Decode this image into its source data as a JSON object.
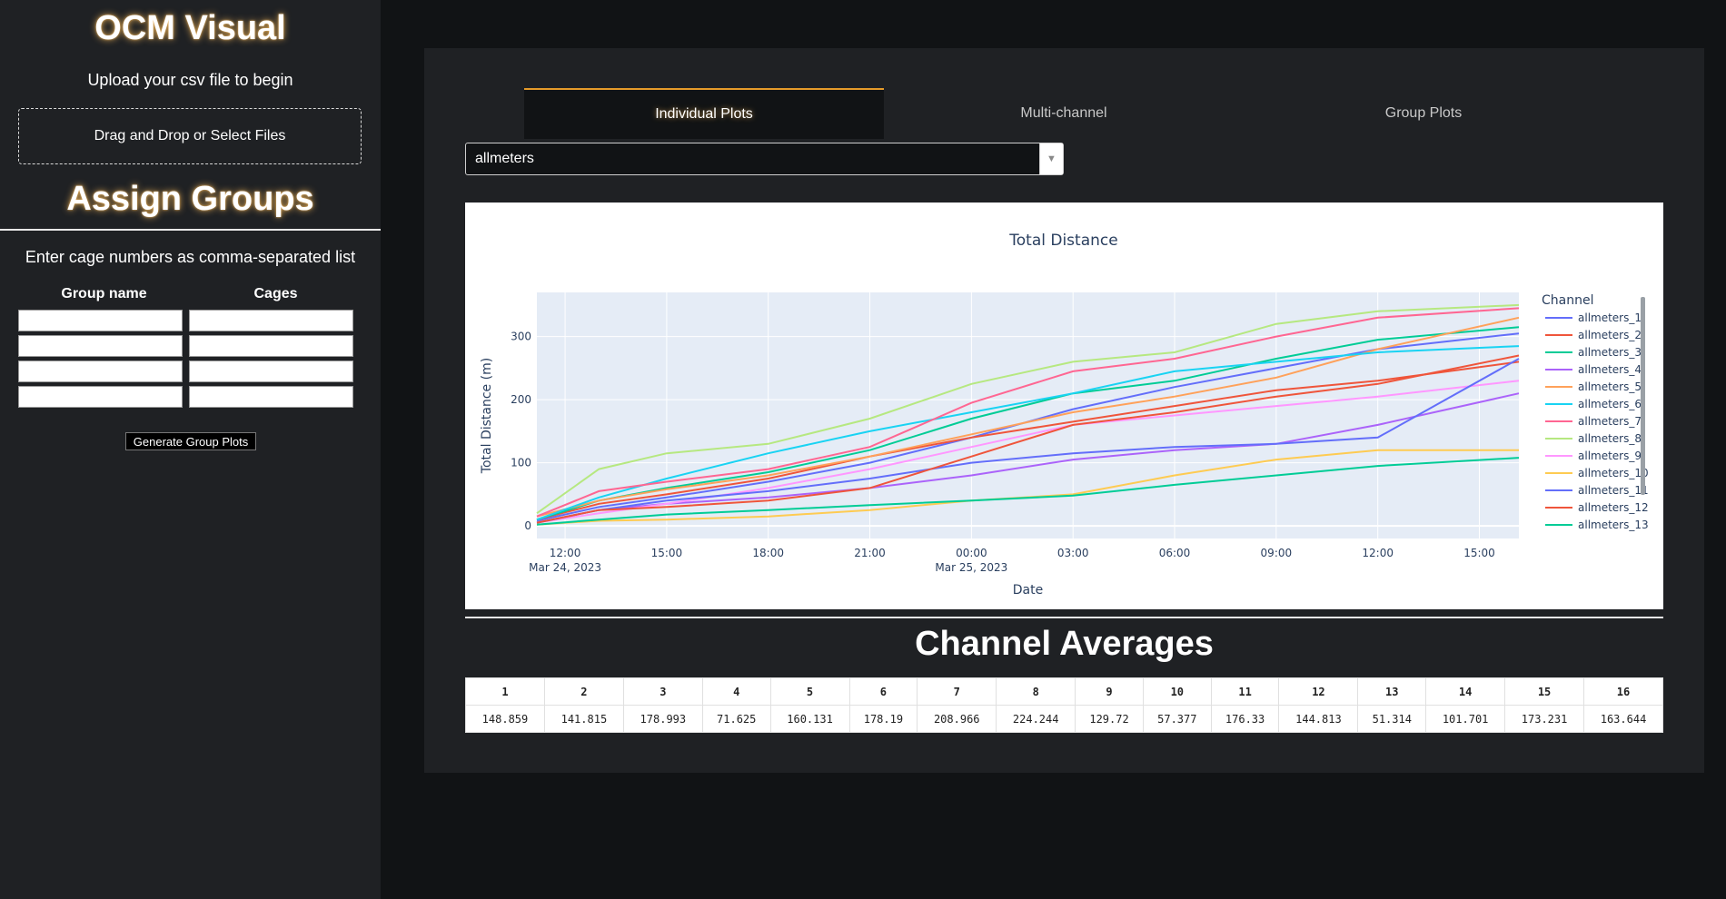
{
  "sidebar": {
    "title": "OCM Visual",
    "upload_prompt": "Upload your csv file to begin",
    "upload_box": "Drag and Drop or Select Files",
    "assign_title": "Assign Groups",
    "instructions": "Enter cage numbers as comma-separated list",
    "col_group": "Group name",
    "col_cages": "Cages",
    "button": "Generate Group Plots"
  },
  "tabs": [
    {
      "label": "Individual Plots",
      "active": true
    },
    {
      "label": "Multi-channel",
      "active": false
    },
    {
      "label": "Group Plots",
      "active": false
    }
  ],
  "dataset_select": {
    "value": "allmeters"
  },
  "chart_data": {
    "type": "line",
    "title": "Total Distance",
    "xlabel": "Date",
    "ylabel": "Total Distance (m)",
    "x_range": [
      "2023-03-24 11:10",
      "2023-03-25 16:10"
    ],
    "ylim": [
      -20,
      370
    ],
    "x_ticks": [
      {
        "t": "2023-03-24 12:00",
        "label": "12:00",
        "sub": "Mar 24, 2023"
      },
      {
        "t": "2023-03-24 15:00",
        "label": "15:00",
        "sub": ""
      },
      {
        "t": "2023-03-24 18:00",
        "label": "18:00",
        "sub": ""
      },
      {
        "t": "2023-03-24 21:00",
        "label": "21:00",
        "sub": ""
      },
      {
        "t": "2023-03-25 00:00",
        "label": "00:00",
        "sub": "Mar 25, 2023"
      },
      {
        "t": "2023-03-25 03:00",
        "label": "03:00",
        "sub": ""
      },
      {
        "t": "2023-03-25 06:00",
        "label": "06:00",
        "sub": ""
      },
      {
        "t": "2023-03-25 09:00",
        "label": "09:00",
        "sub": ""
      },
      {
        "t": "2023-03-25 12:00",
        "label": "12:00",
        "sub": ""
      },
      {
        "t": "2023-03-25 15:00",
        "label": "15:00",
        "sub": ""
      }
    ],
    "y_ticks": [
      0,
      100,
      200,
      300
    ],
    "legend_title": "Channel",
    "legend_position": "right",
    "grid": true,
    "x": [
      "2023-03-24 11:10",
      "2023-03-24 13:00",
      "2023-03-24 15:00",
      "2023-03-24 18:00",
      "2023-03-24 21:00",
      "2023-03-25 00:00",
      "2023-03-25 03:00",
      "2023-03-25 06:00",
      "2023-03-25 09:00",
      "2023-03-25 12:00",
      "2023-03-25 16:10"
    ],
    "series": [
      {
        "name": "allmeters_1",
        "color": "#636efa",
        "values": [
          8,
          30,
          45,
          70,
          100,
          140,
          185,
          220,
          250,
          280,
          305
        ]
      },
      {
        "name": "allmeters_2",
        "color": "#ef553b",
        "values": [
          10,
          35,
          50,
          75,
          110,
          140,
          165,
          190,
          215,
          230,
          260
        ]
      },
      {
        "name": "allmeters_3",
        "color": "#00cc96",
        "values": [
          10,
          40,
          60,
          85,
          120,
          170,
          210,
          230,
          265,
          295,
          315
        ]
      },
      {
        "name": "allmeters_4",
        "color": "#ab63fa",
        "values": [
          5,
          25,
          35,
          45,
          60,
          80,
          105,
          120,
          130,
          160,
          210
        ]
      },
      {
        "name": "allmeters_5",
        "color": "#ffa15a",
        "values": [
          15,
          40,
          58,
          80,
          110,
          145,
          180,
          205,
          235,
          280,
          330
        ]
      },
      {
        "name": "allmeters_6",
        "color": "#19d3f3",
        "values": [
          10,
          45,
          75,
          115,
          150,
          180,
          210,
          245,
          260,
          275,
          285
        ]
      },
      {
        "name": "allmeters_7",
        "color": "#ff6692",
        "values": [
          15,
          55,
          70,
          90,
          125,
          195,
          245,
          265,
          300,
          330,
          345
        ]
      },
      {
        "name": "allmeters_8",
        "color": "#b6e880",
        "values": [
          20,
          90,
          115,
          130,
          170,
          225,
          260,
          275,
          320,
          340,
          350
        ]
      },
      {
        "name": "allmeters_9",
        "color": "#ff97ff",
        "values": [
          5,
          20,
          35,
          60,
          90,
          125,
          160,
          175,
          190,
          205,
          230
        ]
      },
      {
        "name": "allmeters_10",
        "color": "#fecb52",
        "values": [
          2,
          8,
          10,
          15,
          25,
          40,
          50,
          80,
          105,
          120,
          120
        ]
      },
      {
        "name": "allmeters_11",
        "color": "#636efa",
        "values": [
          5,
          25,
          40,
          55,
          75,
          100,
          115,
          125,
          130,
          140,
          265
        ]
      },
      {
        "name": "allmeters_12",
        "color": "#ef553b",
        "values": [
          5,
          25,
          30,
          40,
          60,
          110,
          160,
          180,
          205,
          225,
          270
        ]
      },
      {
        "name": "allmeters_13",
        "color": "#00cc96",
        "values": [
          2,
          10,
          18,
          25,
          33,
          40,
          48,
          65,
          80,
          95,
          108
        ]
      }
    ]
  },
  "averages": {
    "title": "Channel Averages",
    "headers": [
      "1",
      "2",
      "3",
      "4",
      "5",
      "6",
      "7",
      "8",
      "9",
      "10",
      "11",
      "12",
      "13",
      "14",
      "15",
      "16"
    ],
    "values": [
      "148.859",
      "141.815",
      "178.993",
      "71.625",
      "160.131",
      "178.19",
      "208.966",
      "224.244",
      "129.72",
      "57.377",
      "176.33",
      "144.813",
      "51.314",
      "101.701",
      "173.231",
      "163.644"
    ]
  }
}
